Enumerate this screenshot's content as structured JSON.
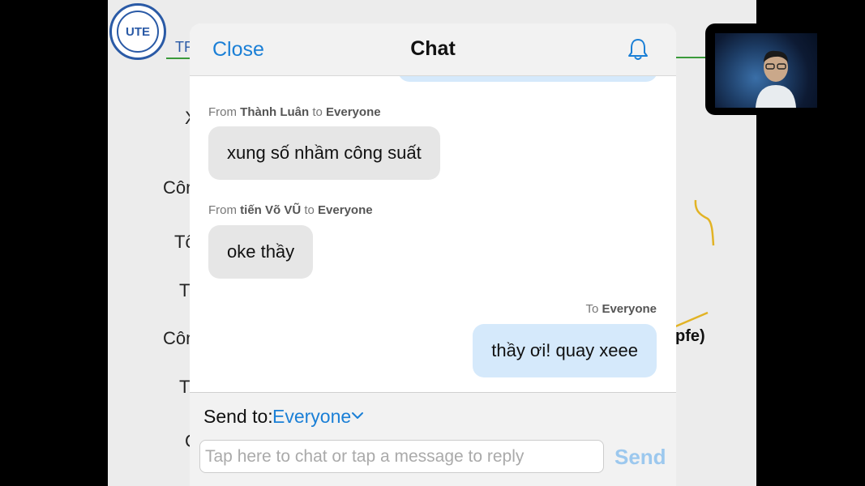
{
  "slide": {
    "logo_text": "UTE",
    "header_text": "TR",
    "side_labels": [
      "X",
      "Côn",
      "Tổ",
      "T",
      "Côn",
      "T",
      "C"
    ],
    "formula": "pfe)"
  },
  "chat": {
    "close_label": "Close",
    "title": "Chat",
    "messages": [
      {
        "direction": "in",
        "from_prefix": "From",
        "sender": "Thành Luân",
        "to_word": "to",
        "recipient": "Everyone",
        "text": "xung số nhầm công suất"
      },
      {
        "direction": "in",
        "from_prefix": "From",
        "sender": "tiến Võ VŨ",
        "to_word": "to",
        "recipient": "Everyone",
        "text": "oke thầy"
      },
      {
        "direction": "out",
        "to_prefix": "To",
        "recipient": "Everyone",
        "text": "thầy ơi! quay xeee"
      }
    ],
    "composer": {
      "send_to_label": "Send to:",
      "send_to_value": "Everyone",
      "input_placeholder": "Tap here to chat or tap a message to reply",
      "send_label": "Send"
    }
  },
  "icons": {
    "bell": "bell-icon",
    "chevron": "chevron-down-icon"
  },
  "colors": {
    "accent": "#1a7fd6",
    "incoming_bubble": "#e6e6e6",
    "outgoing_bubble": "#d5e9fb"
  }
}
